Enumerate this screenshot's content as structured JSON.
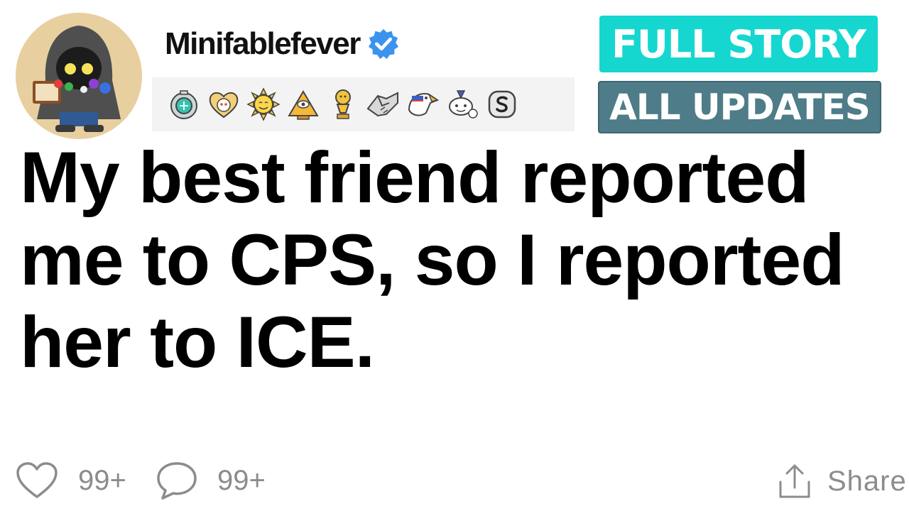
{
  "post": {
    "username": "Minifablefever",
    "title": "My best friend reported me to CPS, so I reported her to ICE.",
    "awards": [
      "silver-gem-award-icon",
      "wholesome-heart-award-icon",
      "sun-award-icon",
      "pyramid-eye-award-icon",
      "gold-trophy-award-icon",
      "handshake-award-icon",
      "eagle-award-icon",
      "party-snoo-award-icon",
      "silver-s-award-icon"
    ]
  },
  "badges": {
    "full_story": "FULL STORY",
    "all_updates": "ALL UPDATES"
  },
  "actions": {
    "likes": "99+",
    "comments": "99+",
    "share_label": "Share"
  },
  "colors": {
    "full_story_bg": "#15d7cf",
    "all_updates_bg": "#4e7c88",
    "verified_blue": "#3a93ef",
    "action_gray": "#8c8c8c"
  }
}
